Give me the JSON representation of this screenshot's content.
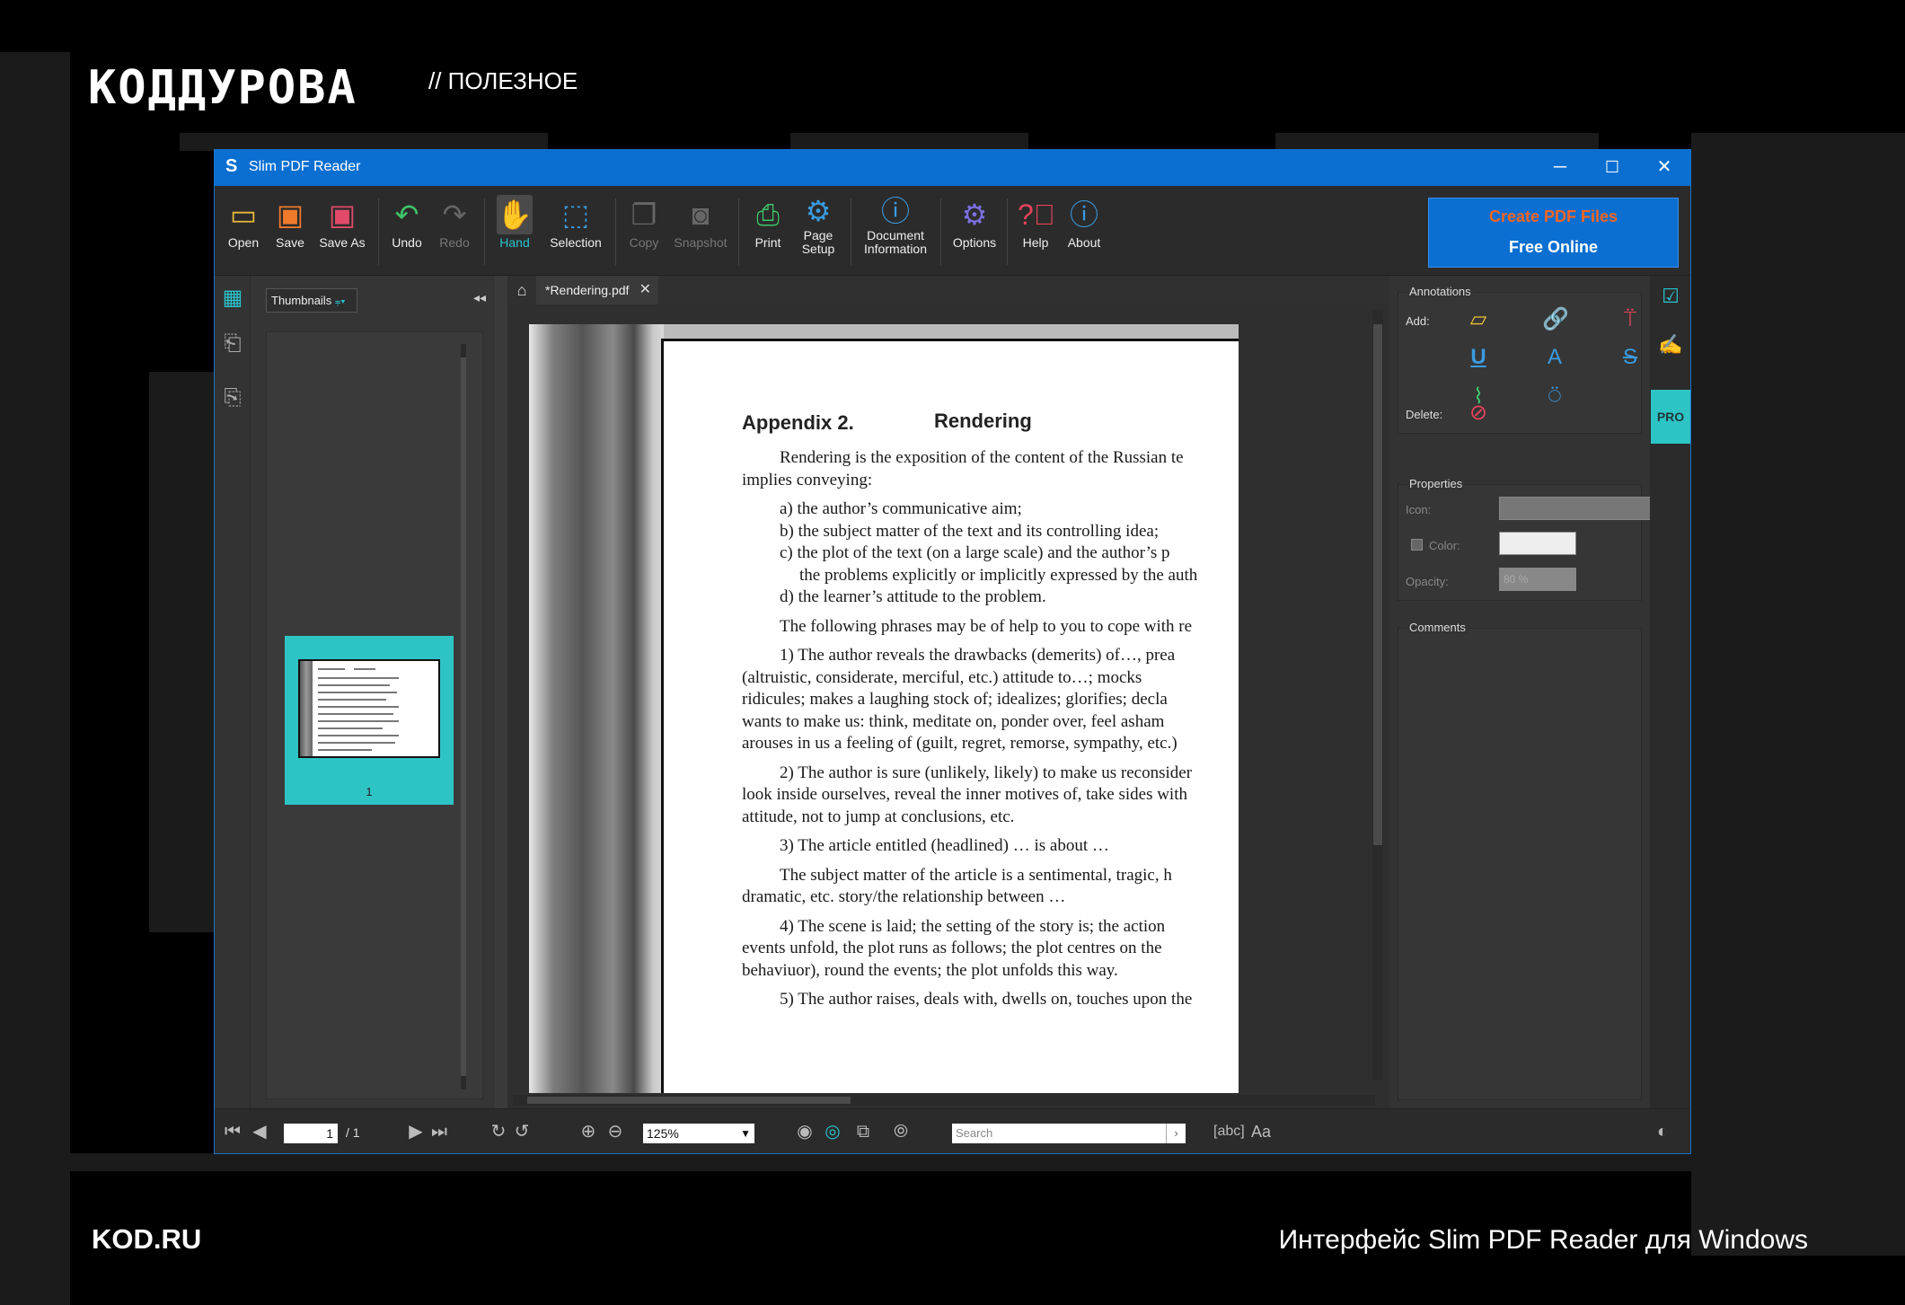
{
  "branding": {
    "logo": "КОДДУРОВА",
    "section": "// ПОЛЕЗНОЕ",
    "site": "KOD.RU",
    "caption": "Интерфейс Slim PDF Reader для Windows"
  },
  "window": {
    "app_icon": "S",
    "title": "Slim PDF Reader",
    "controls": {
      "minimize": "─",
      "maximize": "☐",
      "close": "✕"
    }
  },
  "toolbar": {
    "open": "Open",
    "save": "Save",
    "save_as": "Save As",
    "undo": "Undo",
    "redo": "Redo",
    "hand": "Hand",
    "selection": "Selection",
    "copy": "Copy",
    "snapshot": "Snapshot",
    "print": "Print",
    "page_setup_1": "Page",
    "page_setup_2": "Setup",
    "doc_info_1": "Document",
    "doc_info_2": "Information",
    "options": "Options",
    "help": "Help",
    "about": "About",
    "promo_line1": "Create PDF Files",
    "promo_line2": "Free Online"
  },
  "colors": {
    "accent": "#0a6fd1",
    "teal": "#2ec4c6",
    "promo_orange": "#f26522"
  },
  "sidebar": {
    "view_select": "Thumbnails",
    "collapse": "◂◂",
    "page_number": "1"
  },
  "tabs": {
    "home_icon": "⌂",
    "doc_tab": "*Rendering.pdf",
    "close": "✕"
  },
  "document": {
    "heading_left": "Appendix 2.",
    "heading_right": "Rendering",
    "lines": [
      {
        "cls": "i1",
        "text": "Rendering is the exposition of the content of the Russian te"
      },
      {
        "cls": "",
        "text": "implies conveying:"
      },
      {
        "cls": "gap",
        "text": ""
      },
      {
        "cls": "i1",
        "text": "a) the author’s communicative aim;"
      },
      {
        "cls": "i1",
        "text": "b) the subject matter of the text and its controlling idea;"
      },
      {
        "cls": "i1",
        "text": "c) the plot of the text (on a large scale) and the author’s p"
      },
      {
        "cls": "i2",
        "text": "the problems explicitly or implicitly expressed by the auth"
      },
      {
        "cls": "i1",
        "text": "d) the learner’s attitude to the problem."
      },
      {
        "cls": "gap",
        "text": ""
      },
      {
        "cls": "i1",
        "text": "The following phrases may be of help to you to cope with re"
      },
      {
        "cls": "gap",
        "text": ""
      },
      {
        "cls": "i1",
        "text": "1) The author reveals the drawbacks (demerits) of…, prea"
      },
      {
        "cls": "",
        "text": "(altruistic, considerate, merciful, etc.) attitude to…; mocks"
      },
      {
        "cls": "",
        "text": "ridicules; makes a laughing stock of; idealizes; glorifies; decla"
      },
      {
        "cls": "",
        "text": "wants to make us: think, meditate on, ponder over, feel asham"
      },
      {
        "cls": "",
        "text": "arouses in us a feeling of (guilt, regret, remorse, sympathy, etc.)"
      },
      {
        "cls": "gap",
        "text": ""
      },
      {
        "cls": "i1",
        "text": "2) The author is sure (unlikely, likely) to make us reconsider"
      },
      {
        "cls": "",
        "text": "look inside ourselves, reveal the inner motives of, take sides with"
      },
      {
        "cls": "",
        "text": "attitude, not to jump at conclusions, etc."
      },
      {
        "cls": "gap",
        "text": ""
      },
      {
        "cls": "i1",
        "text": "3) The article entitled (headlined) … is about …"
      },
      {
        "cls": "gap",
        "text": ""
      },
      {
        "cls": "i1",
        "text": "The subject matter of the article is a sentimental, tragic, h"
      },
      {
        "cls": "",
        "text": "dramatic, etc. story/the relationship between …"
      },
      {
        "cls": "gap",
        "text": ""
      },
      {
        "cls": "i1",
        "text": "4) The scene is laid; the setting of the story is; the action"
      },
      {
        "cls": "",
        "text": "events unfold, the plot runs as follows; the plot centres on the"
      },
      {
        "cls": "",
        "text": "behaviuor), round the events; the plot unfolds this way."
      },
      {
        "cls": "gap",
        "text": ""
      },
      {
        "cls": "i1",
        "text": "5) The author raises, deals with, dwells on, touches upon the"
      }
    ]
  },
  "annotations": {
    "title": "Annotations",
    "add_label": "Add:",
    "delete_label": "Delete:"
  },
  "properties": {
    "title": "Properties",
    "icon_label": "Icon:",
    "color_label": "Color:",
    "opacity_label": "Opacity:",
    "opacity_value": "80 %"
  },
  "comments": {
    "title": "Comments"
  },
  "right_strip": {
    "pro_label": "PRO"
  },
  "statusbar": {
    "current_page": "1",
    "total_pages": "/ 1",
    "zoom_value": "125%",
    "search_placeholder": "Search",
    "find_word": "[abc]",
    "match_case": "Aa"
  }
}
